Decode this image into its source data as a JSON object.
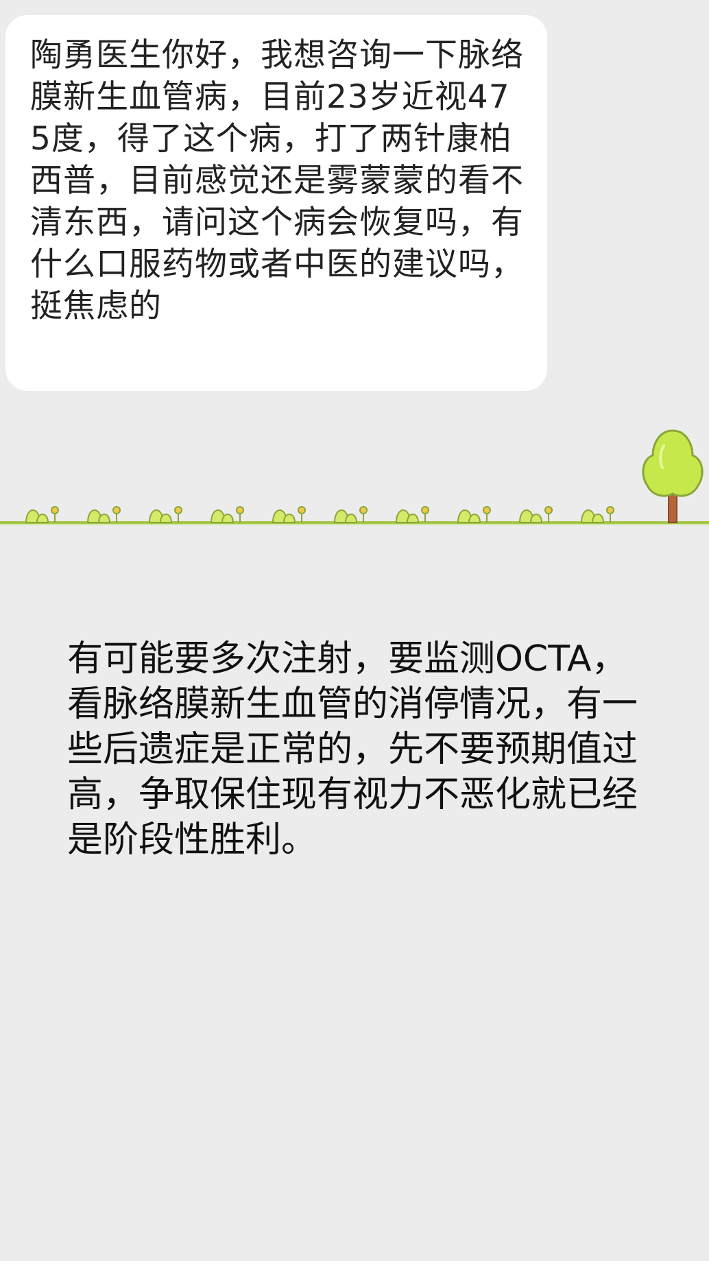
{
  "question": {
    "text": "陶勇医生你好，我想咨询一下脉络膜新生血管病，目前23岁近视475度，得了这个病，打了两针康柏西普，目前感觉还是雾蒙蒙的看不清东西，请问这个病会恢复吗，有什么口服药物或者中医的建议吗，挺焦虑的"
  },
  "reply": {
    "text": "有可能要多次注射，要监测OCTA，看脉络膜新生血管的消停情况，有一些后遗症是正常的，先不要预期值过高，争取保住现有视力不恶化就已经是阶段性胜利。"
  },
  "colors": {
    "background": "#ececec",
    "bubble": "#ffffff",
    "ground_line": "#a4c64a",
    "tree_foliage": "#c6e84a",
    "tree_trunk": "#b5653a"
  }
}
